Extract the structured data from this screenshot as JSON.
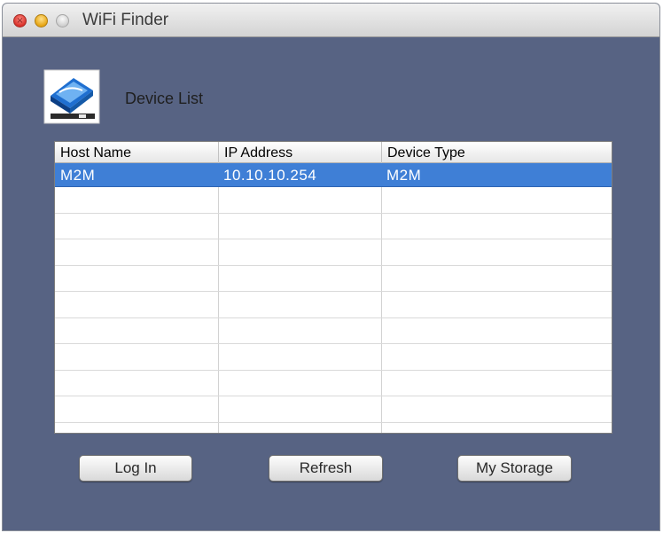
{
  "window": {
    "title": "WiFi Finder"
  },
  "section": {
    "label": "Device List"
  },
  "table": {
    "columns": [
      "Host Name",
      "IP Address",
      "Device Type"
    ],
    "rows": [
      {
        "host": "M2M",
        "ip": "10.10.10.254",
        "type": "M2M",
        "selected": true
      }
    ]
  },
  "buttons": {
    "login": "Log In",
    "refresh": "Refresh",
    "storage": "My Storage"
  },
  "colors": {
    "window_bg": "#576383",
    "selection": "#3f7fd6"
  },
  "icons": {
    "close": "close-icon",
    "minimize": "minimize-icon",
    "zoom": "zoom-icon",
    "logo": "wifi-finder-logo-icon"
  }
}
